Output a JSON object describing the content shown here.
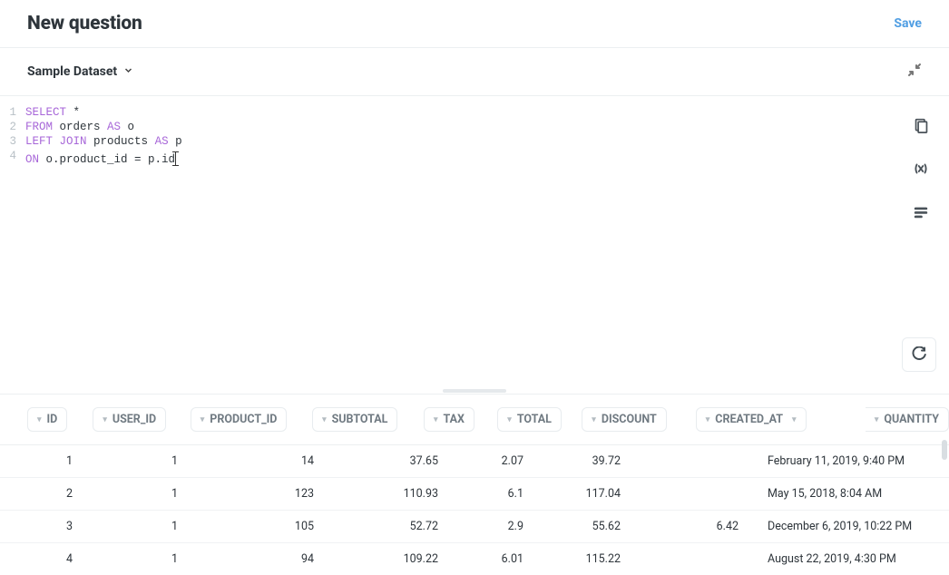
{
  "header": {
    "title": "New question",
    "save_label": "Save"
  },
  "dataset": {
    "name": "Sample Dataset"
  },
  "editor": {
    "lines": [
      {
        "n": "1",
        "tokens": [
          [
            "kw",
            "SELECT"
          ],
          [
            "pl",
            " *"
          ]
        ]
      },
      {
        "n": "2",
        "tokens": [
          [
            "kw",
            "FROM"
          ],
          [
            "pl",
            " orders "
          ],
          [
            "kw",
            "AS"
          ],
          [
            "pl",
            " o"
          ]
        ]
      },
      {
        "n": "3",
        "tokens": [
          [
            "kw",
            "LEFT"
          ],
          [
            "pl",
            " "
          ],
          [
            "kw",
            "JOIN"
          ],
          [
            "pl",
            " products "
          ],
          [
            "kw",
            "AS"
          ],
          [
            "pl",
            " p"
          ]
        ]
      },
      {
        "n": "4",
        "tokens": [
          [
            "kw",
            "ON"
          ],
          [
            "pl",
            " o.product_id = p.id"
          ]
        ]
      }
    ],
    "cursor_line_index": 3
  },
  "results": {
    "columns": [
      "ID",
      "USER_ID",
      "PRODUCT_ID",
      "SUBTOTAL",
      "TAX",
      "TOTAL",
      "DISCOUNT",
      "CREATED_AT",
      "QUANTITY"
    ],
    "rows": [
      {
        "id": "1",
        "user": "1",
        "product": "14",
        "subtotal": "37.65",
        "tax": "2.07",
        "total": "39.72",
        "discount": "",
        "created": "February 11, 2019, 9:40 PM"
      },
      {
        "id": "2",
        "user": "1",
        "product": "123",
        "subtotal": "110.93",
        "tax": "6.1",
        "total": "117.04",
        "discount": "",
        "created": "May 15, 2018, 8:04 AM"
      },
      {
        "id": "3",
        "user": "1",
        "product": "105",
        "subtotal": "52.72",
        "tax": "2.9",
        "total": "55.62",
        "discount": "6.42",
        "created": "December 6, 2019, 10:22 PM"
      },
      {
        "id": "4",
        "user": "1",
        "product": "94",
        "subtotal": "109.22",
        "tax": "6.01",
        "total": "115.22",
        "discount": "",
        "created": "August 22, 2019, 4:30 PM"
      }
    ]
  }
}
